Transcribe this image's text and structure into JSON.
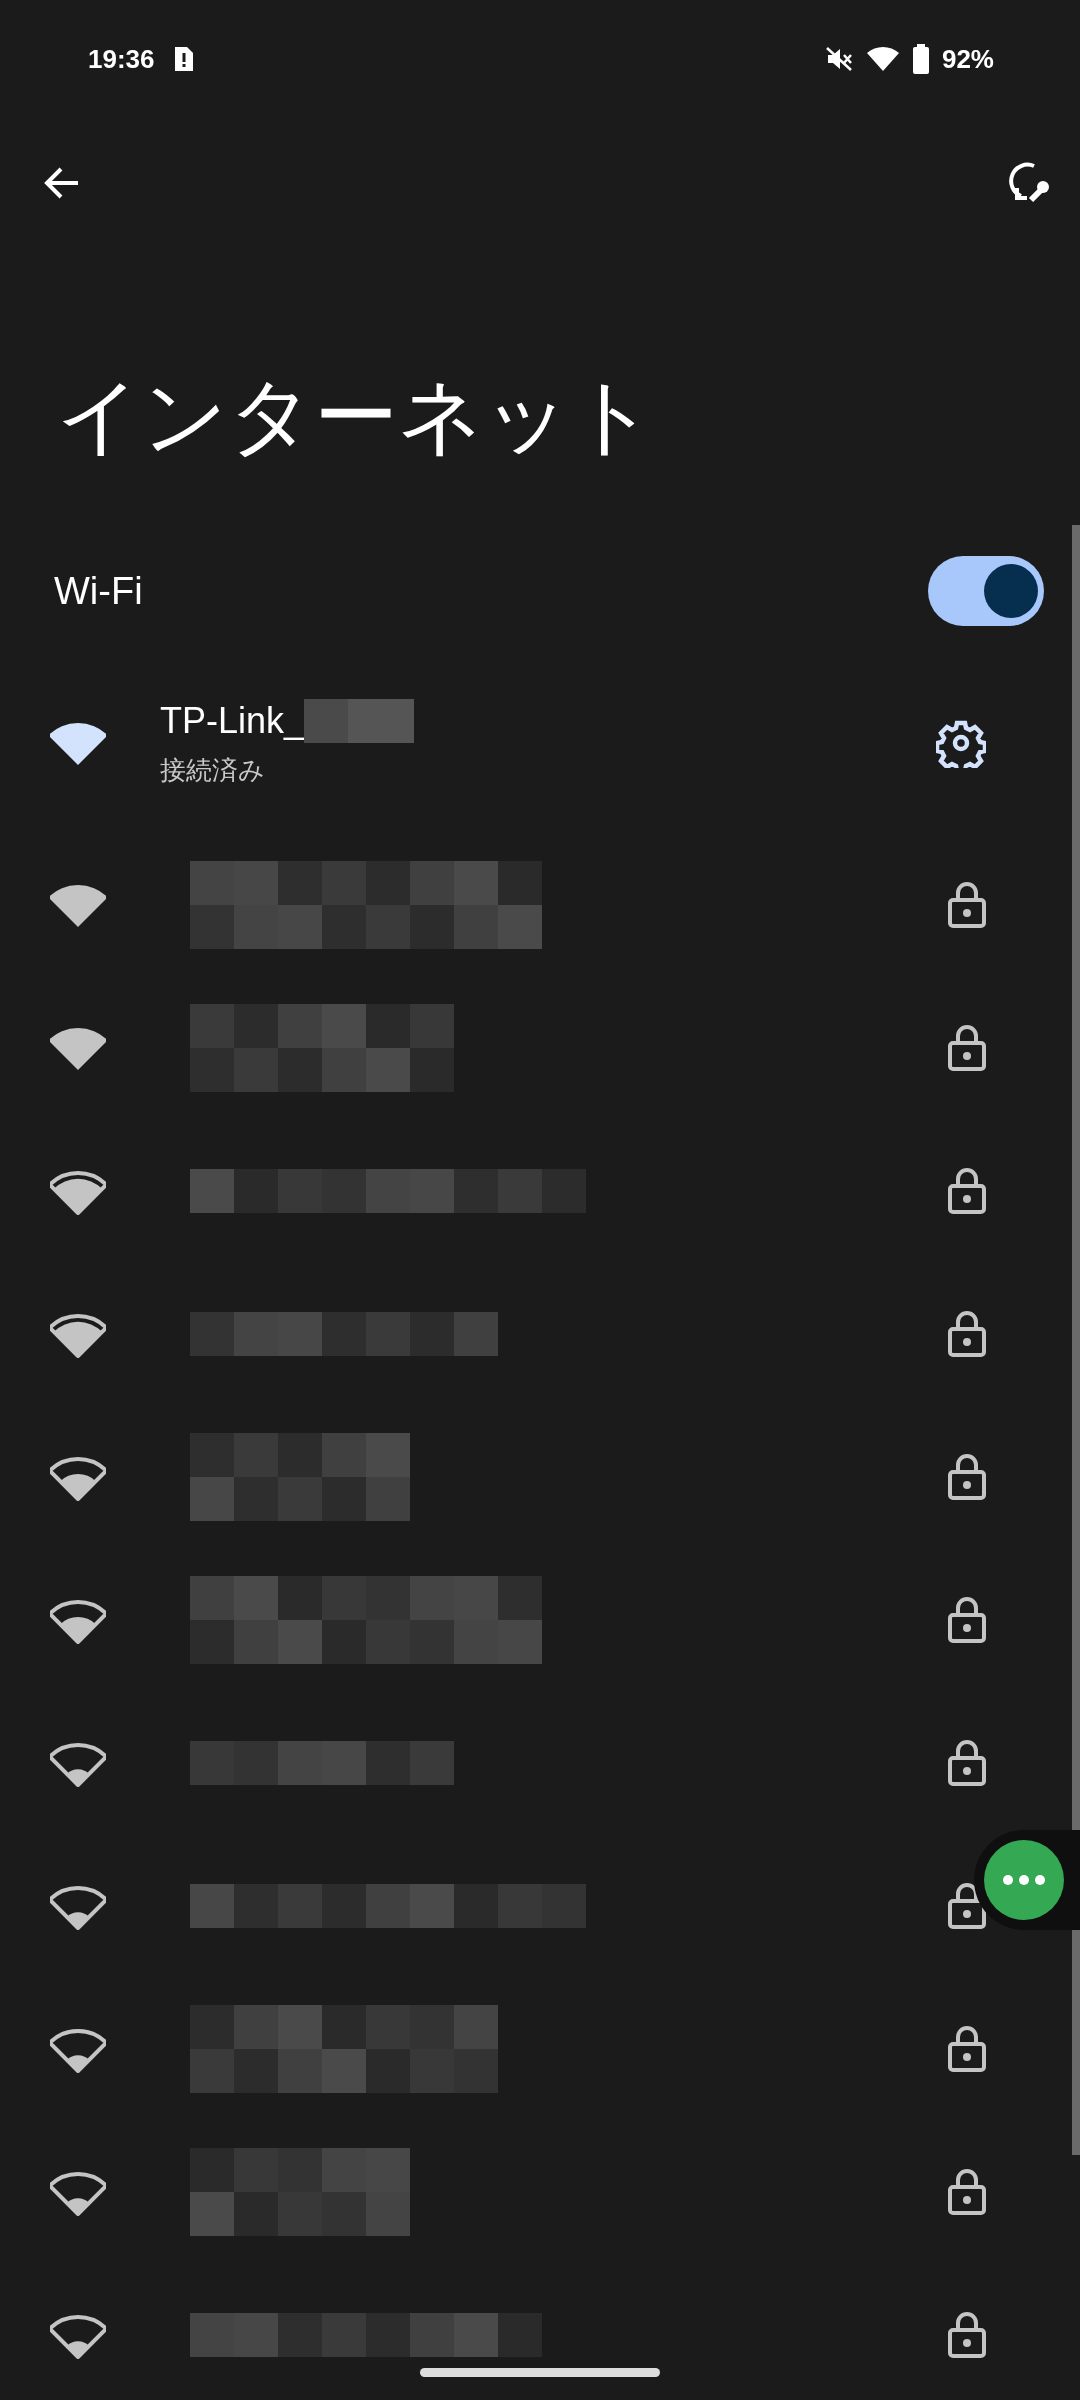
{
  "status_bar": {
    "time": "19:36",
    "battery": "92%"
  },
  "title": "インターネット",
  "wifi": {
    "label": "Wi-Fi",
    "on": true
  },
  "networks": [
    {
      "kind": "connected",
      "name": "TP-Link_",
      "status": "接続済み",
      "signal": {
        "kind": "full"
      }
    },
    {
      "kind": "locked",
      "signal": {
        "kind": "full"
      },
      "name_redaction": {
        "kind": "two-line"
      }
    },
    {
      "kind": "locked",
      "signal": {
        "kind": "full"
      },
      "name_redaction": {
        "kind": "two-line"
      }
    },
    {
      "kind": "locked",
      "signal": {
        "kind": "three"
      },
      "name_redaction": {
        "kind": "one-line"
      }
    },
    {
      "kind": "locked",
      "signal": {
        "kind": "three"
      },
      "name_redaction": {
        "kind": "one-line"
      }
    },
    {
      "kind": "locked",
      "signal": {
        "kind": "two"
      },
      "name_redaction": {
        "kind": "two-line"
      }
    },
    {
      "kind": "locked",
      "signal": {
        "kind": "two"
      },
      "name_redaction": {
        "kind": "two-line"
      }
    },
    {
      "kind": "locked",
      "signal": {
        "kind": "one"
      },
      "name_redaction": {
        "kind": "one-line"
      }
    },
    {
      "kind": "locked",
      "signal": {
        "kind": "one"
      },
      "name_redaction": {
        "kind": "one-line"
      }
    },
    {
      "kind": "locked",
      "signal": {
        "kind": "one"
      },
      "name_redaction": {
        "kind": "two-line"
      }
    },
    {
      "kind": "locked",
      "signal": {
        "kind": "one"
      },
      "name_redaction": {
        "kind": "two-line"
      }
    },
    {
      "kind": "locked",
      "signal": {
        "kind": "one"
      },
      "name_redaction": {
        "kind": "one-line"
      }
    }
  ]
}
